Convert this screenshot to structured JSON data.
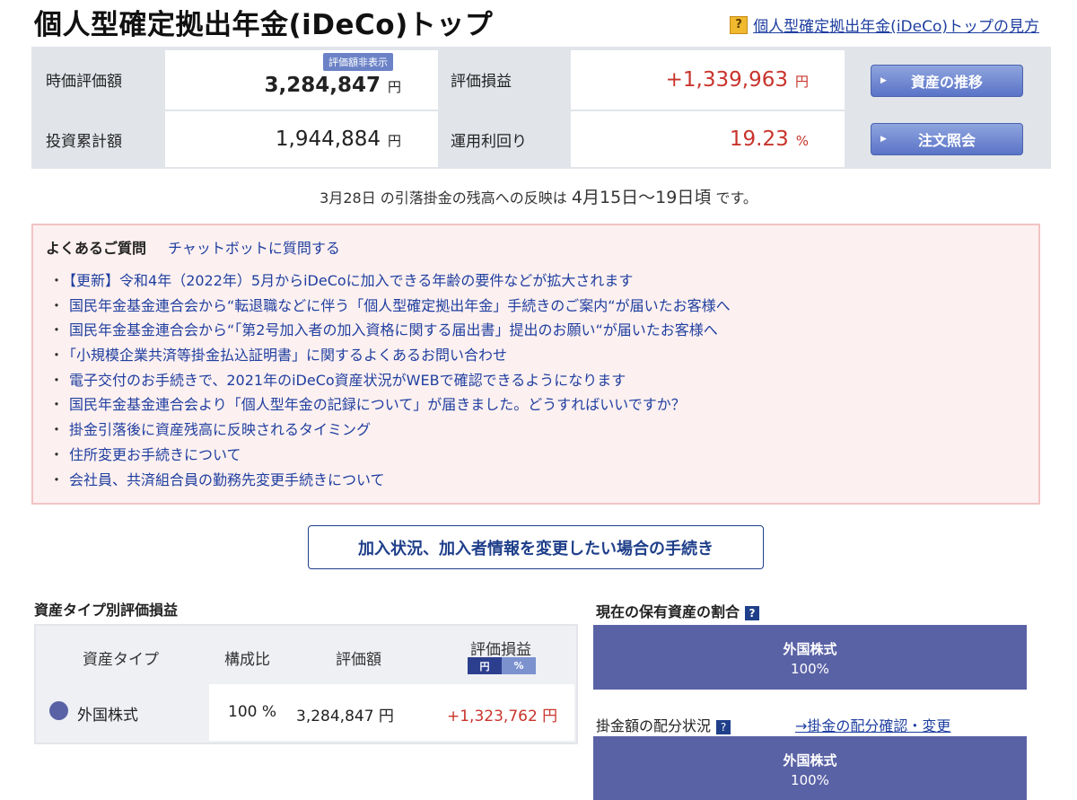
{
  "header": {
    "title": "個人型確定拠出年金(iDeCo)トップ",
    "help_badge": "?",
    "help_link": "個人型確定拠出年金(iDeCo)トップの見方"
  },
  "summary": {
    "market_value_label": "時価評価額",
    "market_value": "3,284,847",
    "hide_badge": "評価額非表示",
    "yen": "円",
    "pl_label": "評価損益",
    "pl_value": "+1,339,963",
    "invested_label": "投資累計額",
    "invested_value": "1,944,884",
    "yield_label": "運用利回り",
    "yield_value": "19.23",
    "percent": "%",
    "btn_asset_trend": "資産の推移",
    "btn_order_inquiry": "注文照会"
  },
  "notice": {
    "part1": "3月28日 の引落掛金の残高への反映は",
    "part2": "4月15日〜19日頃",
    "part3": "です。"
  },
  "faq": {
    "title": "よくあるご質問",
    "chatbot_link": "チャットボットに質問する",
    "items": [
      "【更新】令和4年（2022年）5月からiDeCoに加入できる年齢の要件などが拡大されます",
      "国民年金基金連合会から“転退職などに伴う「個人型確定拠出年金」手続きのご案内“が届いたお客様へ",
      "国民年金基金連合会から“「第2号加入者の加入資格に関する届出書」提出のお願い“が届いたお客様へ",
      "「小規模企業共済等掛金払込証明書」に関するよくあるお問い合わせ",
      "電子交付のお手続きで、2021年のiDeCo資産状況がWEBで確認できるようになります",
      "国民年金基金連合会より「個人型年金の記録について」が届きました。どうすればいいですか？",
      "掛金引落後に資産残高に反映されるタイミング",
      "住所変更お手続きについて",
      "会社員、共済組合員の勤務先変更手続きについて"
    ]
  },
  "procedure_button": "加入状況、加入者情報を変更したい場合の手続き",
  "asset_table": {
    "title": "資産タイプ別評価損益",
    "headers": {
      "type": "資産タイプ",
      "ratio": "構成比",
      "value": "評価額",
      "pl": "評価損益"
    },
    "toggle_yen": "円",
    "toggle_pct": "%",
    "rows": [
      {
        "type": "外国株式",
        "ratio": "100 %",
        "value": "3,284,847 円",
        "pl": "+1,323,762 円",
        "color": "#5a62a6"
      }
    ]
  },
  "holdings": {
    "title": "現在の保有資産の割合",
    "help": "?",
    "segments": [
      {
        "name": "外国株式",
        "percent": "100%",
        "color": "#5a62a6"
      }
    ]
  },
  "contribution": {
    "title": "掛金額の配分状況",
    "help": "?",
    "link": "→掛金の配分確認・変更",
    "segments": [
      {
        "name": "外国株式",
        "percent": "100%",
        "color": "#5a62a6"
      }
    ]
  }
}
